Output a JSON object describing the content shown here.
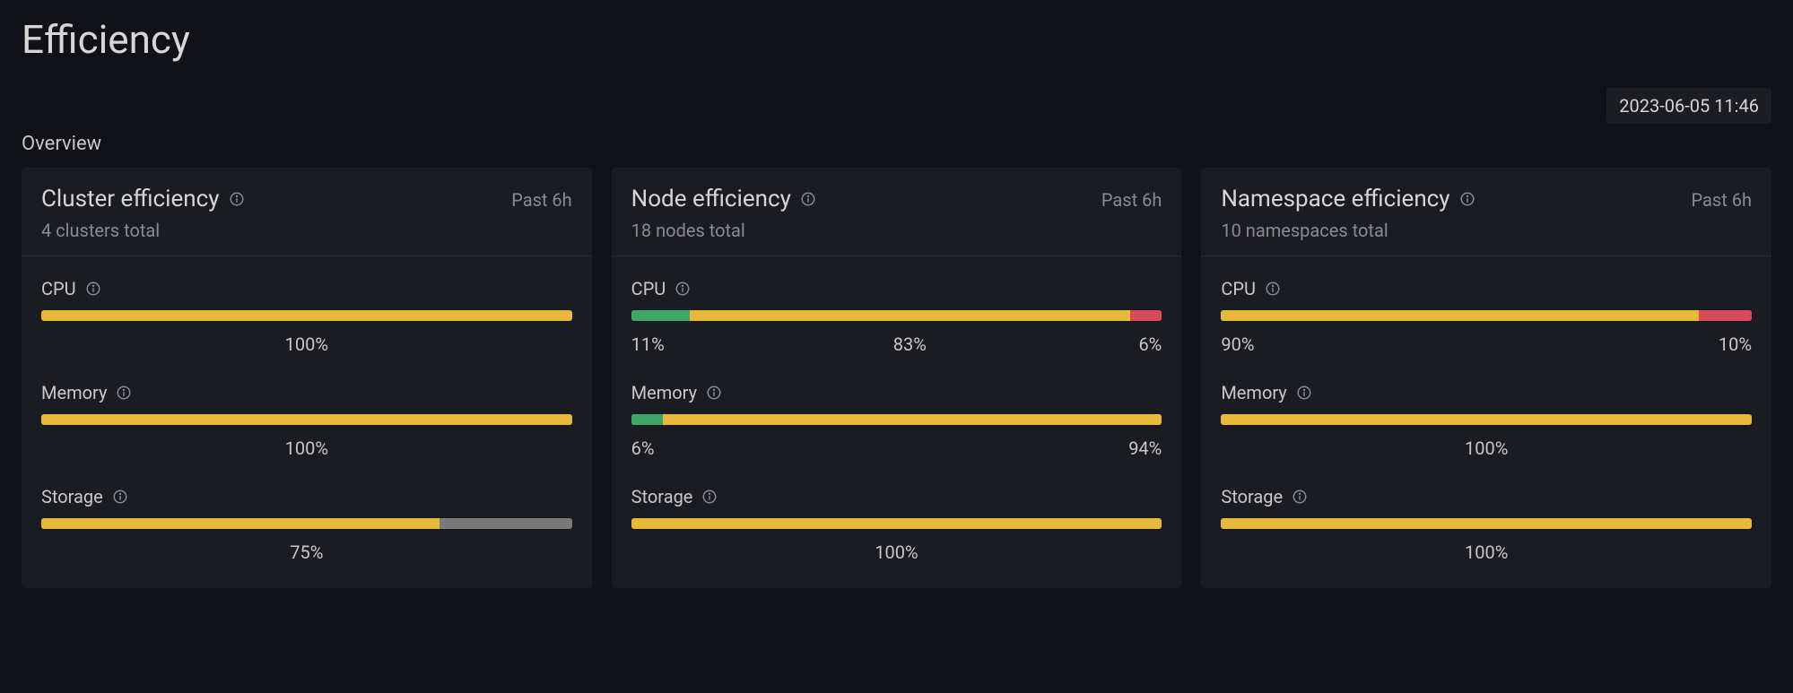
{
  "page": {
    "title": "Efficiency",
    "timestamp": "2023-06-05 11:46",
    "section": "Overview"
  },
  "cards": {
    "cluster": {
      "title": "Cluster efficiency",
      "subtitle": "4 clusters total",
      "period": "Past 6h",
      "metrics": {
        "cpu": {
          "label": "CPU",
          "segments": [
            {
              "color": "yellow",
              "pct": 100,
              "label": "100%"
            }
          ]
        },
        "memory": {
          "label": "Memory",
          "segments": [
            {
              "color": "yellow",
              "pct": 100,
              "label": "100%"
            }
          ]
        },
        "storage": {
          "label": "Storage",
          "segments": [
            {
              "color": "yellow",
              "pct": 75,
              "label": "75%"
            },
            {
              "color": "gray",
              "pct": 25,
              "label": ""
            }
          ]
        }
      }
    },
    "node": {
      "title": "Node efficiency",
      "subtitle": "18 nodes total",
      "period": "Past 6h",
      "metrics": {
        "cpu": {
          "label": "CPU",
          "segments": [
            {
              "color": "green",
              "pct": 11,
              "label": "11%"
            },
            {
              "color": "yellow",
              "pct": 83,
              "label": "83%"
            },
            {
              "color": "red",
              "pct": 6,
              "label": "6%"
            }
          ]
        },
        "memory": {
          "label": "Memory",
          "segments": [
            {
              "color": "green",
              "pct": 6,
              "label": "6%"
            },
            {
              "color": "yellow",
              "pct": 94,
              "label": "94%"
            }
          ]
        },
        "storage": {
          "label": "Storage",
          "segments": [
            {
              "color": "yellow",
              "pct": 100,
              "label": "100%"
            }
          ]
        }
      }
    },
    "namespace": {
      "title": "Namespace efficiency",
      "subtitle": "10 namespaces total",
      "period": "Past 6h",
      "metrics": {
        "cpu": {
          "label": "CPU",
          "segments": [
            {
              "color": "yellow",
              "pct": 90,
              "label": "90%"
            },
            {
              "color": "red",
              "pct": 10,
              "label": "10%"
            }
          ]
        },
        "memory": {
          "label": "Memory",
          "segments": [
            {
              "color": "yellow",
              "pct": 100,
              "label": "100%"
            }
          ]
        },
        "storage": {
          "label": "Storage",
          "segments": [
            {
              "color": "yellow",
              "pct": 100,
              "label": "100%"
            }
          ]
        }
      }
    }
  }
}
